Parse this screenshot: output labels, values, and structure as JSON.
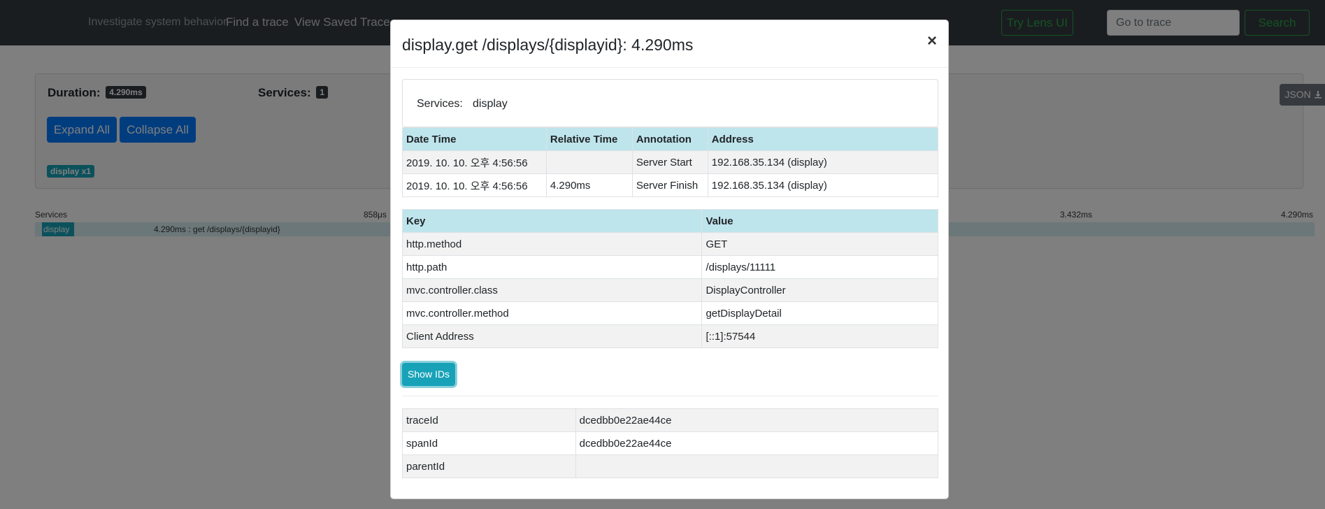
{
  "navbar": {
    "tagline": "Investigate system behavior",
    "links": {
      "find_trace": "Find a trace",
      "saved_trace": "View Saved Trace"
    },
    "lens_button": "Try Lens UI",
    "goto_placeholder": "Go to trace",
    "search_button": "Search"
  },
  "summary": {
    "duration_label": "Duration:",
    "duration_value": "4.290ms",
    "services_label": "Services:",
    "services_count": "1",
    "expand_all": "Expand All",
    "collapse_all": "Collapse All",
    "service_badge": "display x1",
    "json_button": "JSON"
  },
  "timeline": {
    "header_label": "Services",
    "ticks": [
      "858μs",
      "3.432ms",
      "4.290ms"
    ],
    "row": {
      "service": "display",
      "span_text": "4.290ms : get /displays/{displayid}"
    }
  },
  "modal": {
    "title": "display.get /displays/{displayid}: 4.290ms",
    "close_symbol": "×",
    "services_label": "Services:",
    "services_value": "display",
    "annotation_headers": [
      "Date Time",
      "Relative Time",
      "Annotation",
      "Address"
    ],
    "annotations": [
      [
        "2019. 10. 10. 오후 4:56:56",
        "",
        "Server Start",
        "192.168.35.134 (display)"
      ],
      [
        "2019. 10. 10. 오후 4:56:56",
        "4.290ms",
        "Server Finish",
        "192.168.35.134 (display)"
      ]
    ],
    "tag_headers": [
      "Key",
      "Value"
    ],
    "tags": [
      [
        "http.method",
        "GET"
      ],
      [
        "http.path",
        "/displays/11111"
      ],
      [
        "mvc.controller.class",
        "DisplayController"
      ],
      [
        "mvc.controller.method",
        "getDisplayDetail"
      ],
      [
        "Client Address",
        "[::1]:57544"
      ]
    ],
    "show_ids_button": "Show IDs",
    "ids": [
      [
        "traceId",
        "dcedbb0e22ae44ce"
      ],
      [
        "spanId",
        "dcedbb0e22ae44ce"
      ],
      [
        "parentId",
        ""
      ]
    ]
  },
  "colors": {
    "navbar_bg": "#343a40",
    "success_green": "#28a745",
    "primary_blue": "#007bff",
    "info_teal": "#17a2b8",
    "table_header_bg": "#bee5eb"
  }
}
